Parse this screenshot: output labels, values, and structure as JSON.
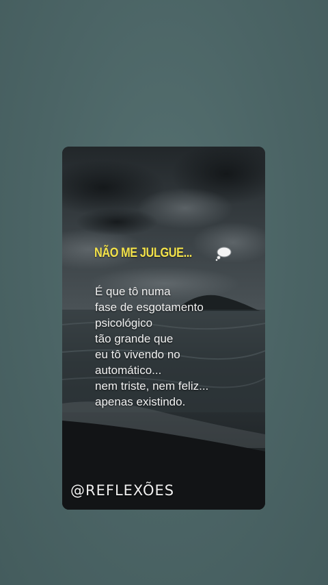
{
  "post": {
    "title": "NÃO ME JULGUE...",
    "title_icon": "thought-bubble-icon",
    "lines": [
      " É que tô numa",
      "fase de esgotamento",
      "psicológico",
      "tão grande que",
      "eu tô vivendo no",
      "automático...",
      "nem triste, nem feliz...",
      "apenas existindo."
    ],
    "handle": "@REFLEXÕES"
  },
  "colors": {
    "page_background": "#4a6364",
    "title": "#f3e24a",
    "text": "#f2f2f2"
  }
}
